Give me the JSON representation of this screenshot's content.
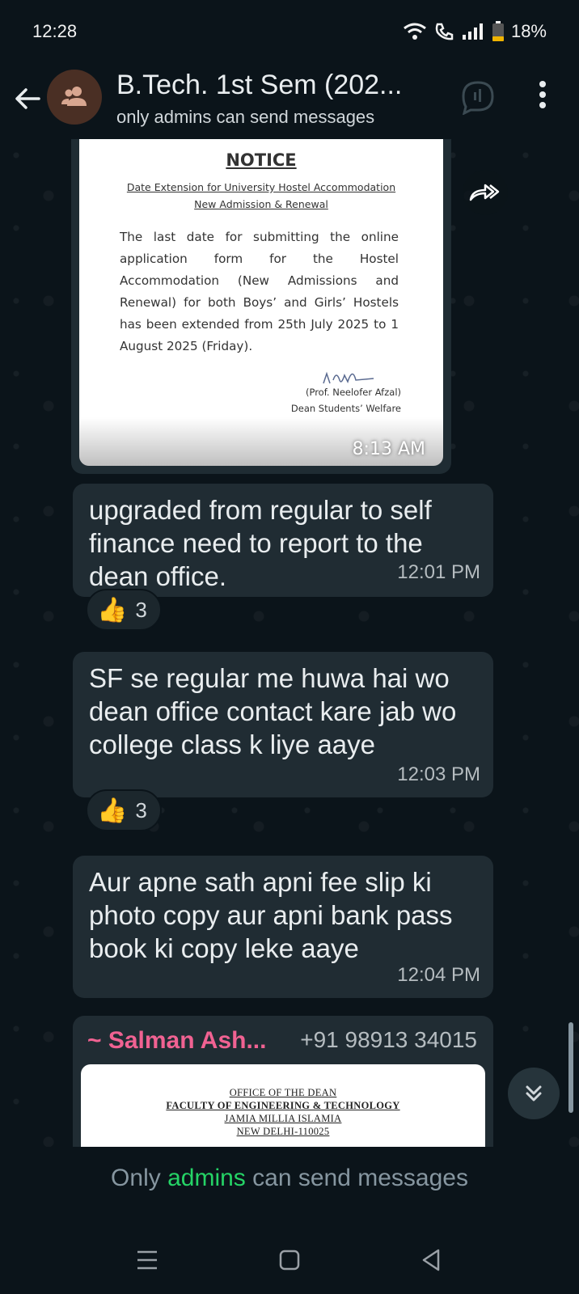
{
  "status_bar": {
    "time": "12:28",
    "battery": "18%"
  },
  "header": {
    "title": "B.Tech. 1st Sem (202...",
    "subtitle": "only admins can send messages"
  },
  "notice": {
    "title": "NOTICE",
    "subtitle1": "Date Extension for University Hostel Accommodation",
    "subtitle2": "New Admission & Renewal",
    "body": "The last date for submitting the online application form for the Hostel Accommodation (New Admissions and Renewal) for both Boys’ and Girls’ Hostels has been extended from 25th July 2025 to 1 August 2025 (Friday).",
    "sign_name": "(Prof. Neelofer Afzal)",
    "sign_title": "Dean Students’ Welfare",
    "time": "8:13 AM"
  },
  "messages": [
    {
      "text": "upgraded from regular to self finance need to report to the dean office.",
      "time": "12:01 PM",
      "reaction": {
        "emoji": "👍",
        "count": "3"
      }
    },
    {
      "text": "SF se regular me huwa hai wo dean office contact kare jab wo college class k liye aaye",
      "time": "12:03 PM",
      "reaction": {
        "emoji": "👍",
        "count": "3"
      }
    },
    {
      "text": "Aur apne sath apni fee slip ki photo copy aur apni bank pass book ki copy leke aaye",
      "time": "12:04 PM"
    }
  ],
  "last_message": {
    "sender": "~ Salman Ash...",
    "phone": "+91 98913 34015",
    "doc_lines": [
      "OFFICE OF THE DEAN",
      "FACULTY OF ENGINEERING & TECHNOLOGY",
      "JAMIA MILLIA ISLAMIA",
      "NEW DELHI-110025"
    ]
  },
  "footer": {
    "prefix": "Only ",
    "admins": "admins",
    "suffix": " can send messages"
  },
  "colors": {
    "background": "#0b141a",
    "bubble": "#202c33",
    "accent": "#25d366",
    "sender": "#f06292"
  },
  "icons": [
    "wifi-icon",
    "call-icon",
    "signal-icon",
    "battery-icon",
    "back-arrow-icon",
    "group-avatar-icon",
    "voice-chat-icon",
    "more-vert-icon",
    "forward-icon",
    "scroll-down-icon",
    "menu-nav-icon",
    "home-nav-icon",
    "back-nav-icon"
  ]
}
